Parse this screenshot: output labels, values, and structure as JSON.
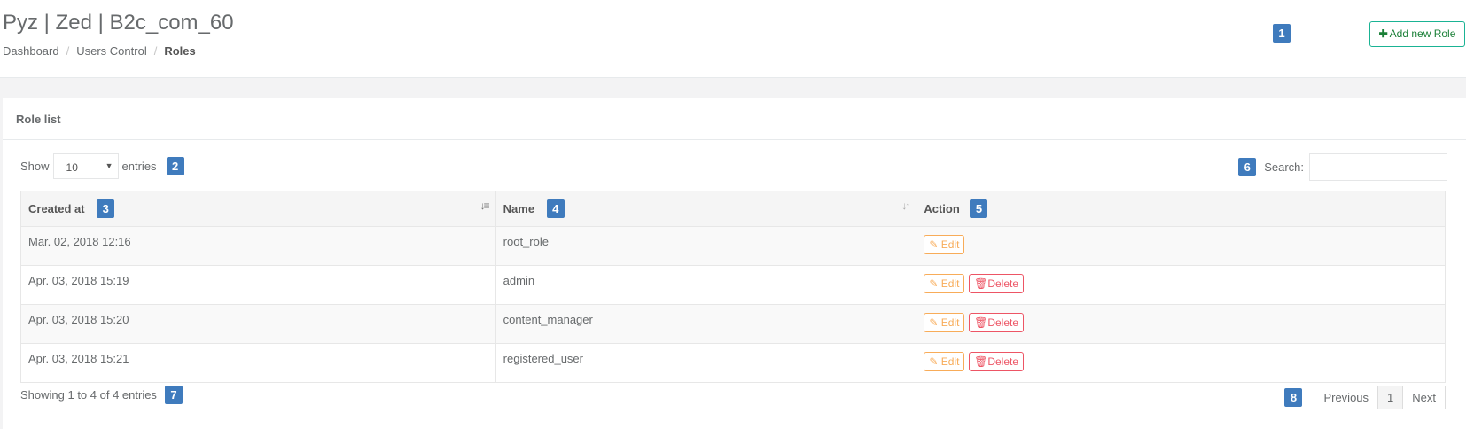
{
  "header": {
    "title": "Pyz | Zed | B2c_com_60",
    "breadcrumb": [
      "Dashboard",
      "Users Control",
      "Roles"
    ],
    "separator": "/",
    "add_button": {
      "icon": "plus-icon",
      "label": "Add new Role"
    }
  },
  "markers": [
    "1",
    "2",
    "3",
    "4",
    "5",
    "6",
    "7",
    "8"
  ],
  "panel": {
    "title": "Role list",
    "length": {
      "prefix": "Show",
      "value": "10",
      "suffix": "entries"
    },
    "search_label": "Search:",
    "search_value": "",
    "columns": [
      "Created at",
      "Name",
      "Action"
    ],
    "rows": [
      {
        "created": "Mar. 02, 2018 12:16",
        "name": "root_role",
        "edit": "Edit",
        "delete": null
      },
      {
        "created": "Apr. 03, 2018 15:19",
        "name": "admin",
        "edit": "Edit",
        "delete": "Delete"
      },
      {
        "created": "Apr. 03, 2018 15:20",
        "name": "content_manager",
        "edit": "Edit",
        "delete": "Delete"
      },
      {
        "created": "Apr. 03, 2018 15:21",
        "name": "registered_user",
        "edit": "Edit",
        "delete": "Delete"
      }
    ],
    "info": "Showing 1 to 4 of 4 entries",
    "pagination": {
      "prev": "Previous",
      "current": "1",
      "next": "Next"
    }
  },
  "colors": {
    "accent": "#1ab394",
    "marker": "#3f7bbd",
    "edit": "#f8ac59",
    "delete": "#ed5565"
  }
}
